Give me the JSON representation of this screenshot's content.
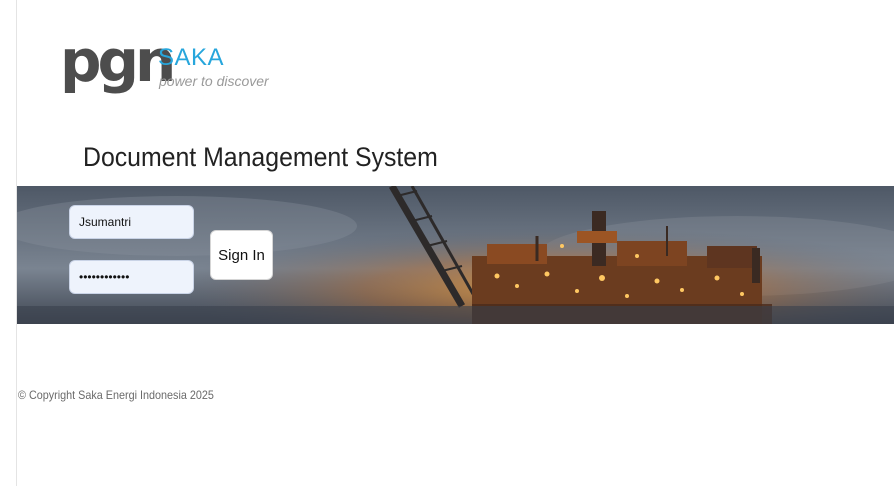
{
  "brand": {
    "wordmark": "pgn",
    "name": "SAKA",
    "tagline": "power to discover"
  },
  "app": {
    "title": "Document Management System"
  },
  "login": {
    "username_value": "Jsumantri",
    "password_value": "ssssssssssss",
    "signin_label": "Sign In"
  },
  "footer": {
    "copyright": "© Copyright Saka Energi Indonesia 2025"
  },
  "colors": {
    "brand_blue": "#27a6dc",
    "brand_gray": "#4d4d4d",
    "field_bg": "#eef3fc"
  }
}
